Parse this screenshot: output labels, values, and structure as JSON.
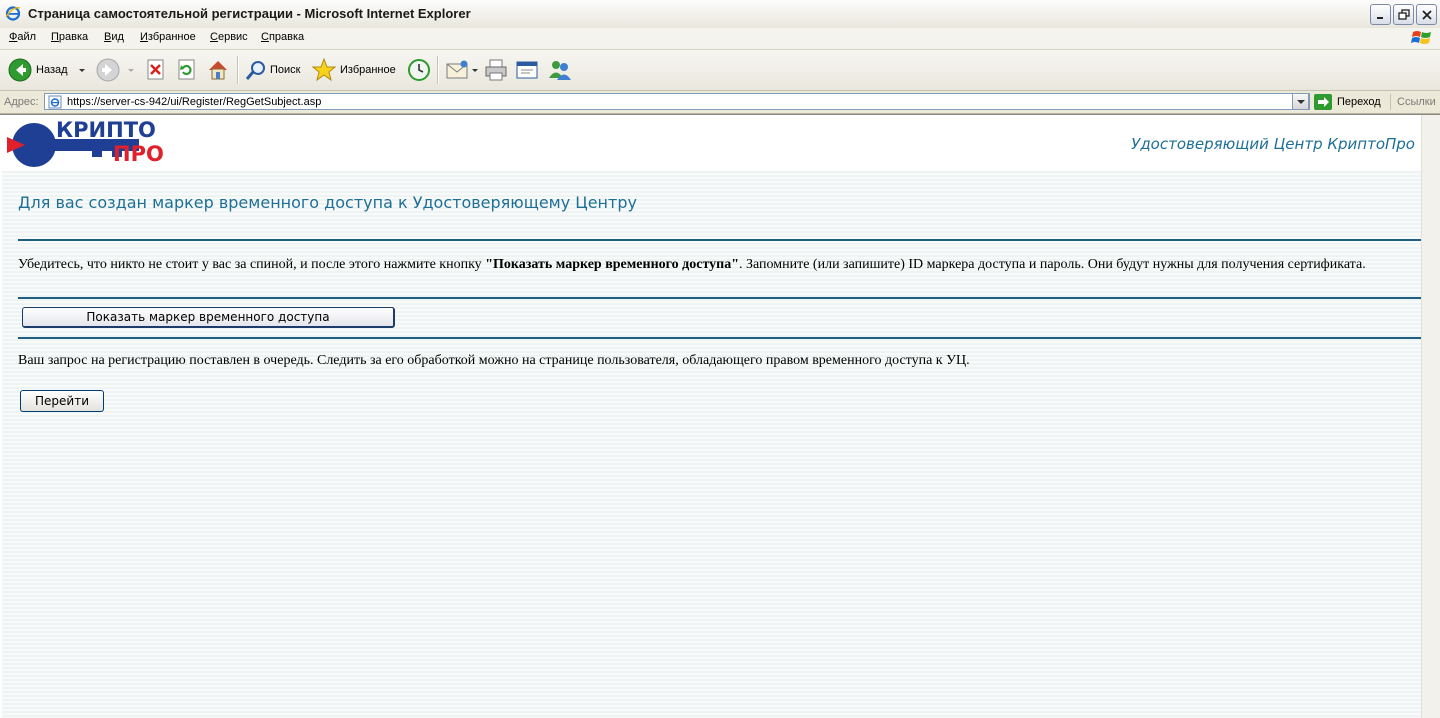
{
  "window": {
    "title": "Страница самостоятельной регистрации - Microsoft Internet Explorer"
  },
  "menu": {
    "items": [
      {
        "first": "Ф",
        "rest": "айл"
      },
      {
        "first": "П",
        "rest": "равка"
      },
      {
        "first": "В",
        "rest": "ид"
      },
      {
        "first": "И",
        "rest": "збранное"
      },
      {
        "first": "С",
        "rest": "ервис"
      },
      {
        "first": "С",
        "rest": "правка"
      }
    ]
  },
  "toolbar": {
    "back_label": "Назад",
    "search_label": "Поиск",
    "favorites_label": "Избранное"
  },
  "address": {
    "label": "Адрес:",
    "url": "https://server-cs-942/ui/Register/RegGetSubject.asp",
    "go_label": "Переход",
    "links_label": "Ссылки"
  },
  "page": {
    "logo_top": "КРИПТО",
    "logo_bottom": "ПРО",
    "ca_name": "Удостоверяющий Центр КриптоПро",
    "heading": "Для вас создан маркер временного доступа к Удостоверяющему Центру",
    "notice_before": "Убедитесь, что никто не стоит у вас за спиной, и после этого нажмите кнопку ",
    "notice_bold": "\"Показать маркер временного доступа\"",
    "notice_after": ". Запомните (или запишите) ID маркера доступа и пароль. Они будут нужны для получения сертификата.",
    "show_button_label": "Показать маркер временного доступа",
    "queue_text": "Ваш запрос на регистрацию поставлен в очередь. Следить за его обработкой можно на странице пользователя, обладающего правом временного доступа к УЦ.",
    "go_button_label": "Перейти"
  },
  "colors": {
    "accent": "#1e6f96",
    "rule": "#1e5f80",
    "logo_blue": "#1f3f95",
    "logo_red": "#e0202a"
  }
}
